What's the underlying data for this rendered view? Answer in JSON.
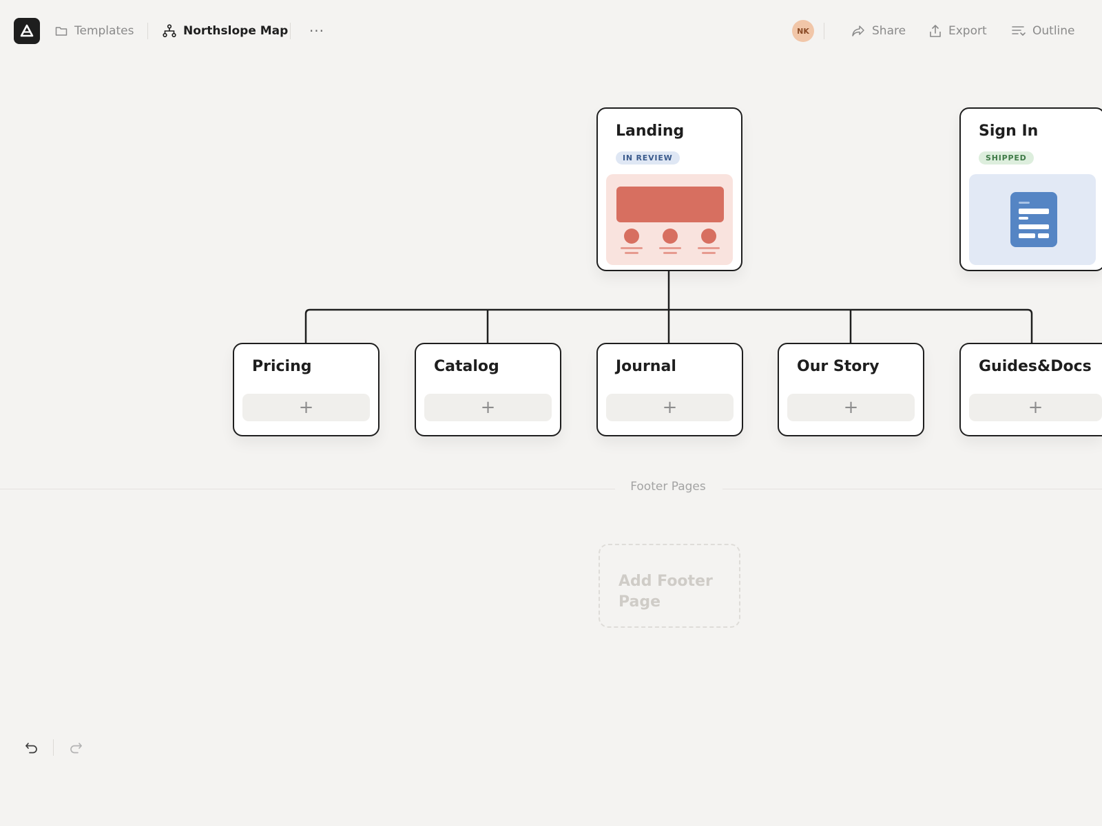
{
  "topbar": {
    "breadcrumb": {
      "templates_label": "Templates",
      "map_label": "Northslope Map"
    },
    "more_label": "···",
    "avatar_initials": "NK",
    "actions": {
      "share_label": "Share",
      "export_label": "Export",
      "outline_label": "Outline"
    }
  },
  "sitemap": {
    "root": {
      "title": "Landing",
      "status": "IN REVIEW",
      "preview_icon": "layout-wireframe-icon"
    },
    "secondary": {
      "title": "Sign In",
      "status": "SHIPPED",
      "preview_icon": "document-icon"
    },
    "children": [
      {
        "title": "Pricing",
        "add_label": "+"
      },
      {
        "title": "Catalog",
        "add_label": "+"
      },
      {
        "title": "Journal",
        "add_label": "+"
      },
      {
        "title": "Our Story",
        "add_label": "+"
      },
      {
        "title": "Guides&Docs",
        "add_label": "+"
      }
    ]
  },
  "footer": {
    "section_label": "Footer Pages",
    "add_label": "Add Footer Page"
  },
  "history": {
    "undo_icon": "undo-icon",
    "redo_icon": "redo-icon"
  },
  "colors": {
    "background": "#f4f3f1",
    "card_border": "#1e1e1e",
    "review_badge": "#dfe7f4",
    "shipped_badge": "#ddeedd",
    "landing_accent": "#d76f60",
    "signin_accent": "#5585c4",
    "avatar": "#f1c6a8"
  }
}
